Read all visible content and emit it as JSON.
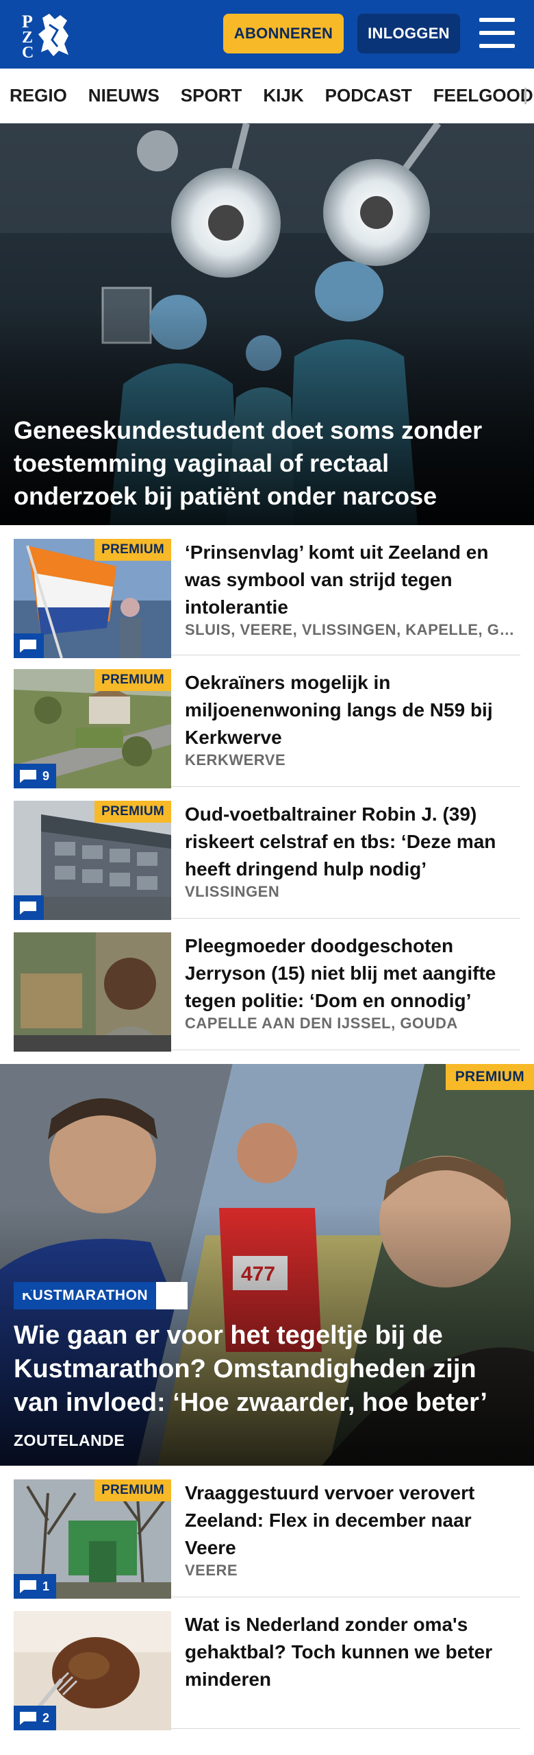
{
  "header": {
    "logo_text": "PZC",
    "subscribe_label": "ABONNEREN",
    "login_label": "INLOGGEN"
  },
  "nav": {
    "items": [
      "REGIO",
      "NIEUWS",
      "SPORT",
      "KIJK",
      "PODCAST",
      "FEELGOOD"
    ]
  },
  "hero": {
    "title": "Geneeskundestudent doet soms zonder toestemming vaginaal of rectaal onderzoek bij patiënt onder narcose"
  },
  "articles": [
    {
      "premium": "PREMIUM",
      "comments": "",
      "title": "‘Prinsenvlag’ komt uit Zeeland en was symbool van strijd tegen intolerantie",
      "location": "SLUIS, VEERE, VLISSINGEN, KAPELLE, GOES"
    },
    {
      "premium": "PREMIUM",
      "comments": "9",
      "title": "Oekraïners mogelijk in miljoenenwoning langs de N59 bij Kerkwerve",
      "location": "KERKWERVE"
    },
    {
      "premium": "PREMIUM",
      "comments": "",
      "title": "Oud-voetbaltrainer Robin J. (39) riskeert celstraf en tbs: ‘Deze man heeft dringend hulp nodig’",
      "location": "VLISSINGEN"
    },
    {
      "premium": "",
      "comments": "",
      "title": "Pleegmoeder doodgeschoten Jerryson (15) niet blij met aangifte tegen politie: ‘Dom en onnodig’",
      "location": "CAPELLE AAN DEN IJSSEL, GOUDA"
    }
  ],
  "feature": {
    "premium": "PREMIUM",
    "kicker": "KUSTMARATHON",
    "title": "Wie gaan er voor het tegeltje bij de Kustmarathon? Omstandigheden zijn van invloed: ‘Hoe zwaarder, hoe beter’",
    "location": "ZOUTELANDE"
  },
  "articles2": [
    {
      "premium": "PREMIUM",
      "comments": "1",
      "title": "Vraaggestuurd vervoer verovert Zeeland: Flex in december naar Veere",
      "location": "VEERE"
    },
    {
      "premium": "",
      "comments": "2",
      "title": "Wat is Nederland zonder oma's gehaktbal? Toch kunnen we beter minderen",
      "location": ""
    }
  ],
  "colors": {
    "brand_blue": "#0b4aa8",
    "premium_yellow": "#f7b928",
    "login_blue": "#0a3478"
  },
  "icons": [
    "pzc-logo",
    "hamburger-menu-icon",
    "comment-icon"
  ]
}
